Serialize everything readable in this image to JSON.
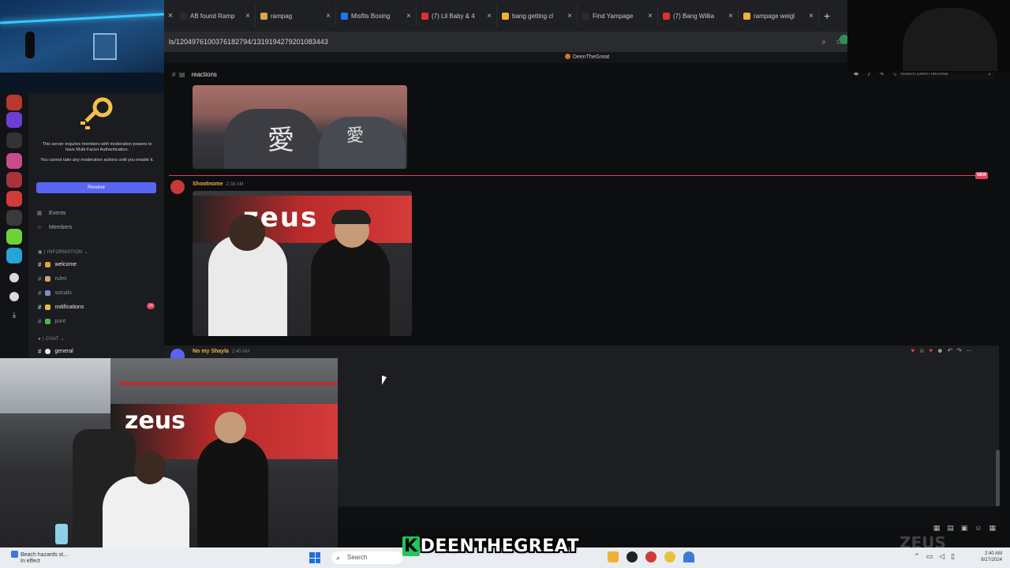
{
  "browser": {
    "tabs": [
      {
        "title": "AB found Ramp",
        "color": "#2b2b2b"
      },
      {
        "title": "rampag",
        "color": "#e0a24a"
      },
      {
        "title": "Misfits Boxing",
        "color": "#1877f2"
      },
      {
        "title": "(7) Lil Baby & 4",
        "color": "#e03030"
      },
      {
        "title": "bang getting cl",
        "color": "#f2b033"
      },
      {
        "title": "Find Yampage",
        "color": "#2b2b2b"
      },
      {
        "title": "(7) Bang Willia",
        "color": "#e03030"
      },
      {
        "title": "rampage weigl",
        "color": "#f2b033"
      }
    ],
    "url": "ls/1204976100376182794/1319194279201083443",
    "new_tab": "+"
  },
  "discord": {
    "window_title": "DeenTheGreat",
    "channel": "reactions",
    "search_placeholder": "Search DeenTheGreat",
    "new_label": "NEW",
    "mfa_title": "This server requires members with moderation powers to have Multi-Factor Authentication.",
    "mfa_sub": "You cannot take any moderation actions until you enable it.",
    "resolve_label": "Resolve",
    "events_label": "Events",
    "members_label": "Members",
    "cat_information": "INFORMATION",
    "cat_chat": "CHAT",
    "channels": {
      "welcome": "welcome",
      "rules": "rules",
      "socials": "socials",
      "notifications": "notifications",
      "punt": "punt",
      "general": "general"
    },
    "notif_badge": "24",
    "messages": [
      {
        "author": "Shootnome",
        "time": "2:38 AM",
        "color": "#e6b24a"
      },
      {
        "author": "No my Shayla",
        "time": "2:40 AM",
        "color": "#e6b24a"
      }
    ],
    "img1_text": "愛",
    "img2_brand": "zeus"
  },
  "stream": {
    "caption_k": "K",
    "caption_rest": "DEENTHEGREAT",
    "watermark": "ZEUS",
    "cam_brand": "zeus"
  },
  "taskbar": {
    "widget_line1": "Beach hazards st...",
    "widget_line2": "In effect",
    "search_label": "Search",
    "time": "2:40 AM",
    "date": "8/27/2024"
  },
  "icons": {
    "search": "search-icon",
    "star": "star-icon",
    "key": "key-icon"
  }
}
